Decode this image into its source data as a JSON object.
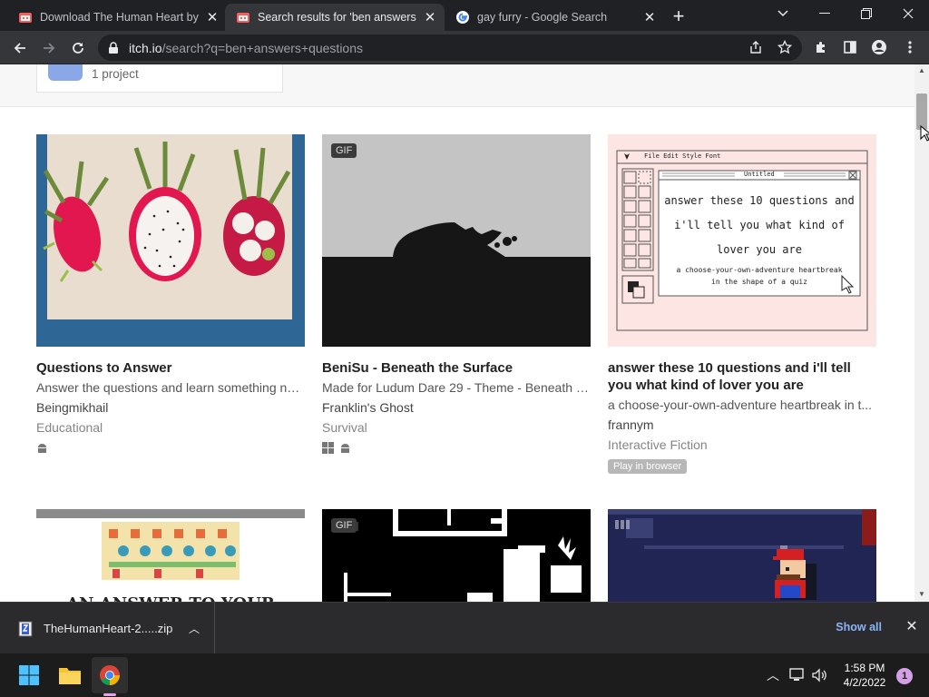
{
  "browser": {
    "tabs": [
      {
        "title": "Download The Human Heart by L",
        "favicon": "itchio-icon"
      },
      {
        "title": "Search results for 'ben answers q",
        "favicon": "itchio-icon",
        "active": true
      },
      {
        "title": "gay furry - Google Search",
        "favicon": "google-icon"
      }
    ],
    "new_tab_label": "+",
    "url_host": "itch.io",
    "url_path": "/search?q=ben+answers+questions"
  },
  "page": {
    "top_card_label": "1 project",
    "games": [
      {
        "title": "Questions to Answer",
        "description": "Answer the questions and learn something new!",
        "author": "Beingmikhail",
        "genre": "Educational",
        "platforms": [
          "android-icon"
        ]
      },
      {
        "title": "BeniSu - Beneath the Surface",
        "description": "Made for Ludum Dare 29 - Theme - Beneath th...",
        "author": "Franklin's Ghost",
        "genre": "Survival",
        "platforms": [
          "windows-icon",
          "android-icon"
        ],
        "badge": "GIF"
      },
      {
        "title": "answer these 10 questions and i'll tell you what kind of lover you are",
        "description": "a choose-your-own-adventure heartbreak in t...",
        "author": "frannym",
        "genre": "Interactive Fiction",
        "play_badge": "Play in browser",
        "cover_window_title": "Untitled",
        "cover_menu": "File  Edit  Style  Font",
        "cover_heading_lines": [
          "answer these 10 questions and",
          "i'll tell you what kind of",
          "lover you are"
        ],
        "cover_sub_lines": [
          "a choose-your-own-adventure heartbreak",
          "in the shape of a quiz"
        ]
      }
    ],
    "second_row_badge": "GIF",
    "row2_cover1_text": "AN ANSWER TO YOUR"
  },
  "downloads": {
    "file_name": "TheHumanHeart-2.....zip",
    "show_all": "Show all"
  },
  "taskbar": {
    "time": "1:58 PM",
    "date": "4/2/2022",
    "notification_count": "1"
  }
}
